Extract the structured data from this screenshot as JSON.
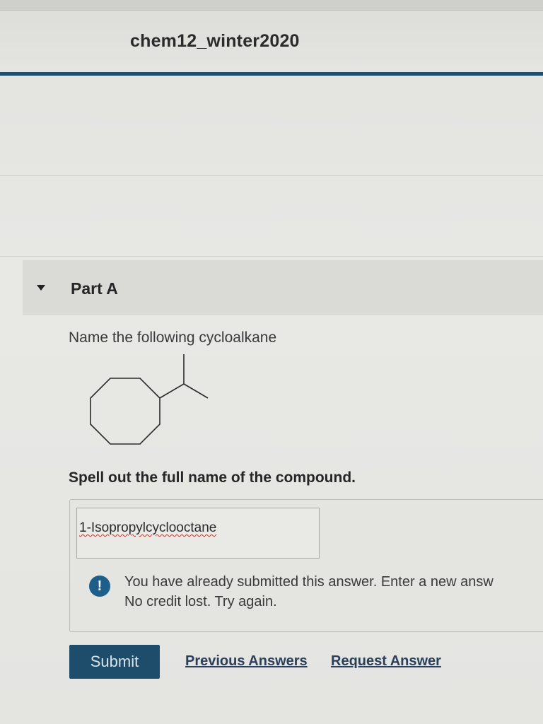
{
  "header": {
    "course_title": "chem12_winter2020"
  },
  "part": {
    "title": "Part A",
    "question": "Name the following cycloalkane",
    "instruction": "Spell out the full name of the compound."
  },
  "answer": {
    "value": "1-Isopropylcyclooctane"
  },
  "feedback": {
    "line1": "You have already submitted this answer. Enter a new answ",
    "line2": "No credit lost. Try again.",
    "icon_symbol": "!"
  },
  "actions": {
    "submit_label": "Submit",
    "previous_answers_label": "Previous Answers",
    "request_answer_label": "Request Answer"
  },
  "colors": {
    "accent": "#1f4f6e",
    "submit_bg": "#1e4d6b",
    "info_icon": "#1d5f8a",
    "spellcheck": "#c0392b"
  }
}
